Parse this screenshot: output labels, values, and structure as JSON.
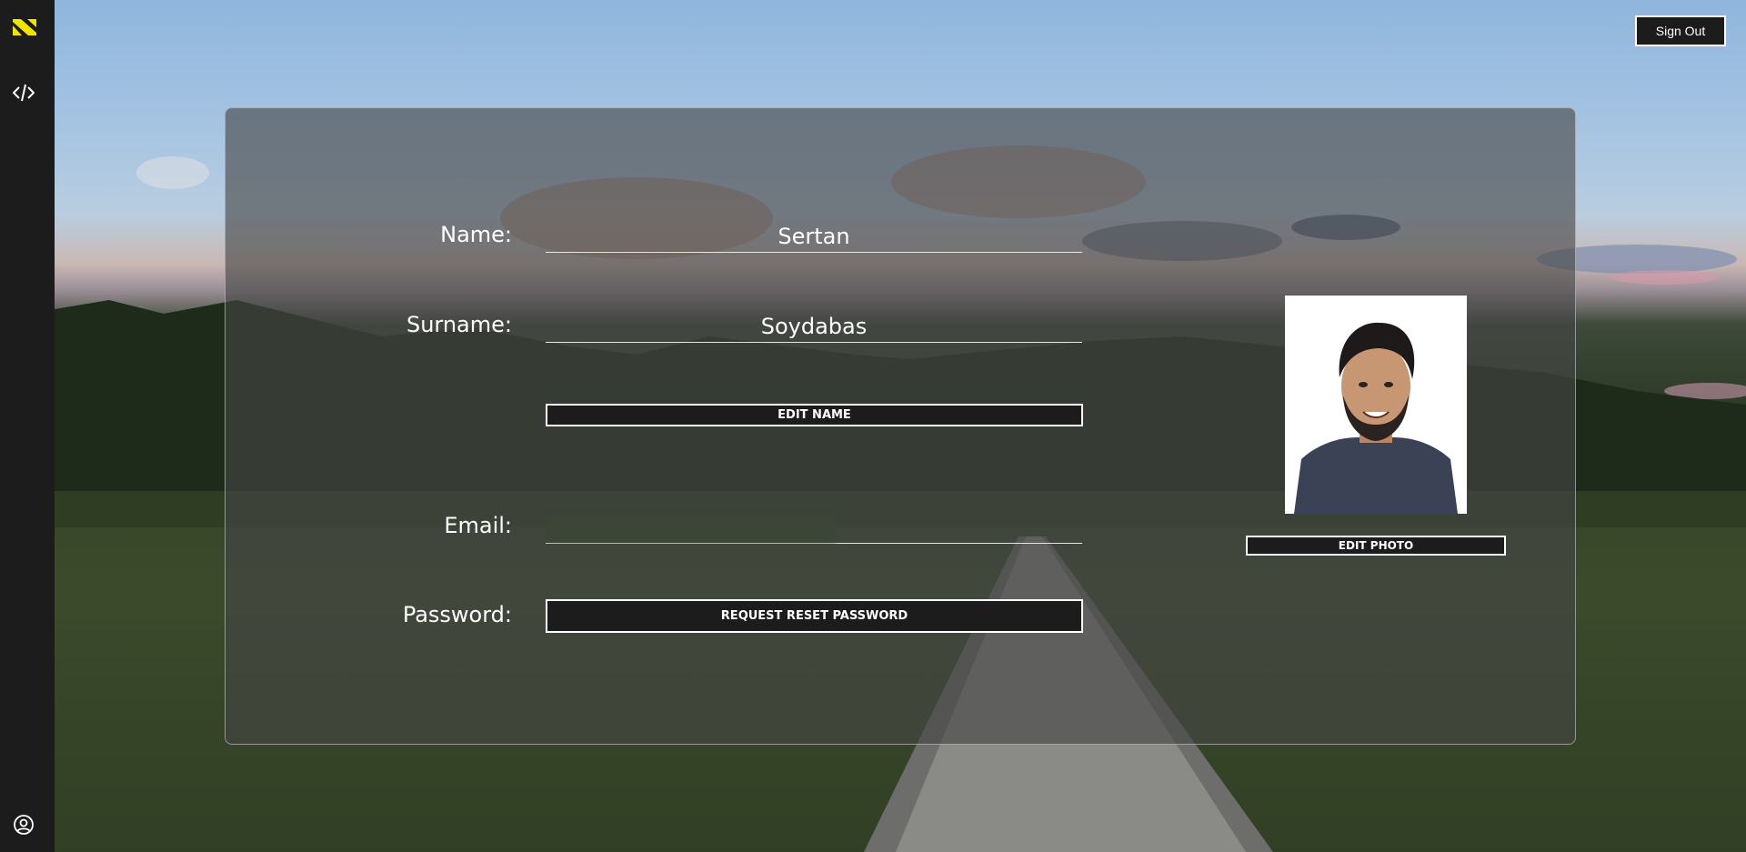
{
  "header": {
    "signout_label": "Sign Out"
  },
  "sidebar": {
    "items": [
      {
        "icon": "logo-icon"
      },
      {
        "icon": "code-icon"
      },
      {
        "icon": "user-circle-icon"
      }
    ]
  },
  "profile": {
    "name_label": "Name:",
    "name_value": "Sertan",
    "surname_label": "Surname:",
    "surname_value": "Soydabas",
    "edit_name_label": "EDIT NAME",
    "email_label": "Email:",
    "email_value": "",
    "password_label": "Password:",
    "reset_password_label": "REQUEST RESET PASSWORD",
    "edit_photo_label": "EDIT PHOTO"
  },
  "colors": {
    "sidebar_bg": "#1c1c1c",
    "logo_accent": "#f2e300",
    "button_bg": "#1c1c1c",
    "text": "#ffffff"
  }
}
